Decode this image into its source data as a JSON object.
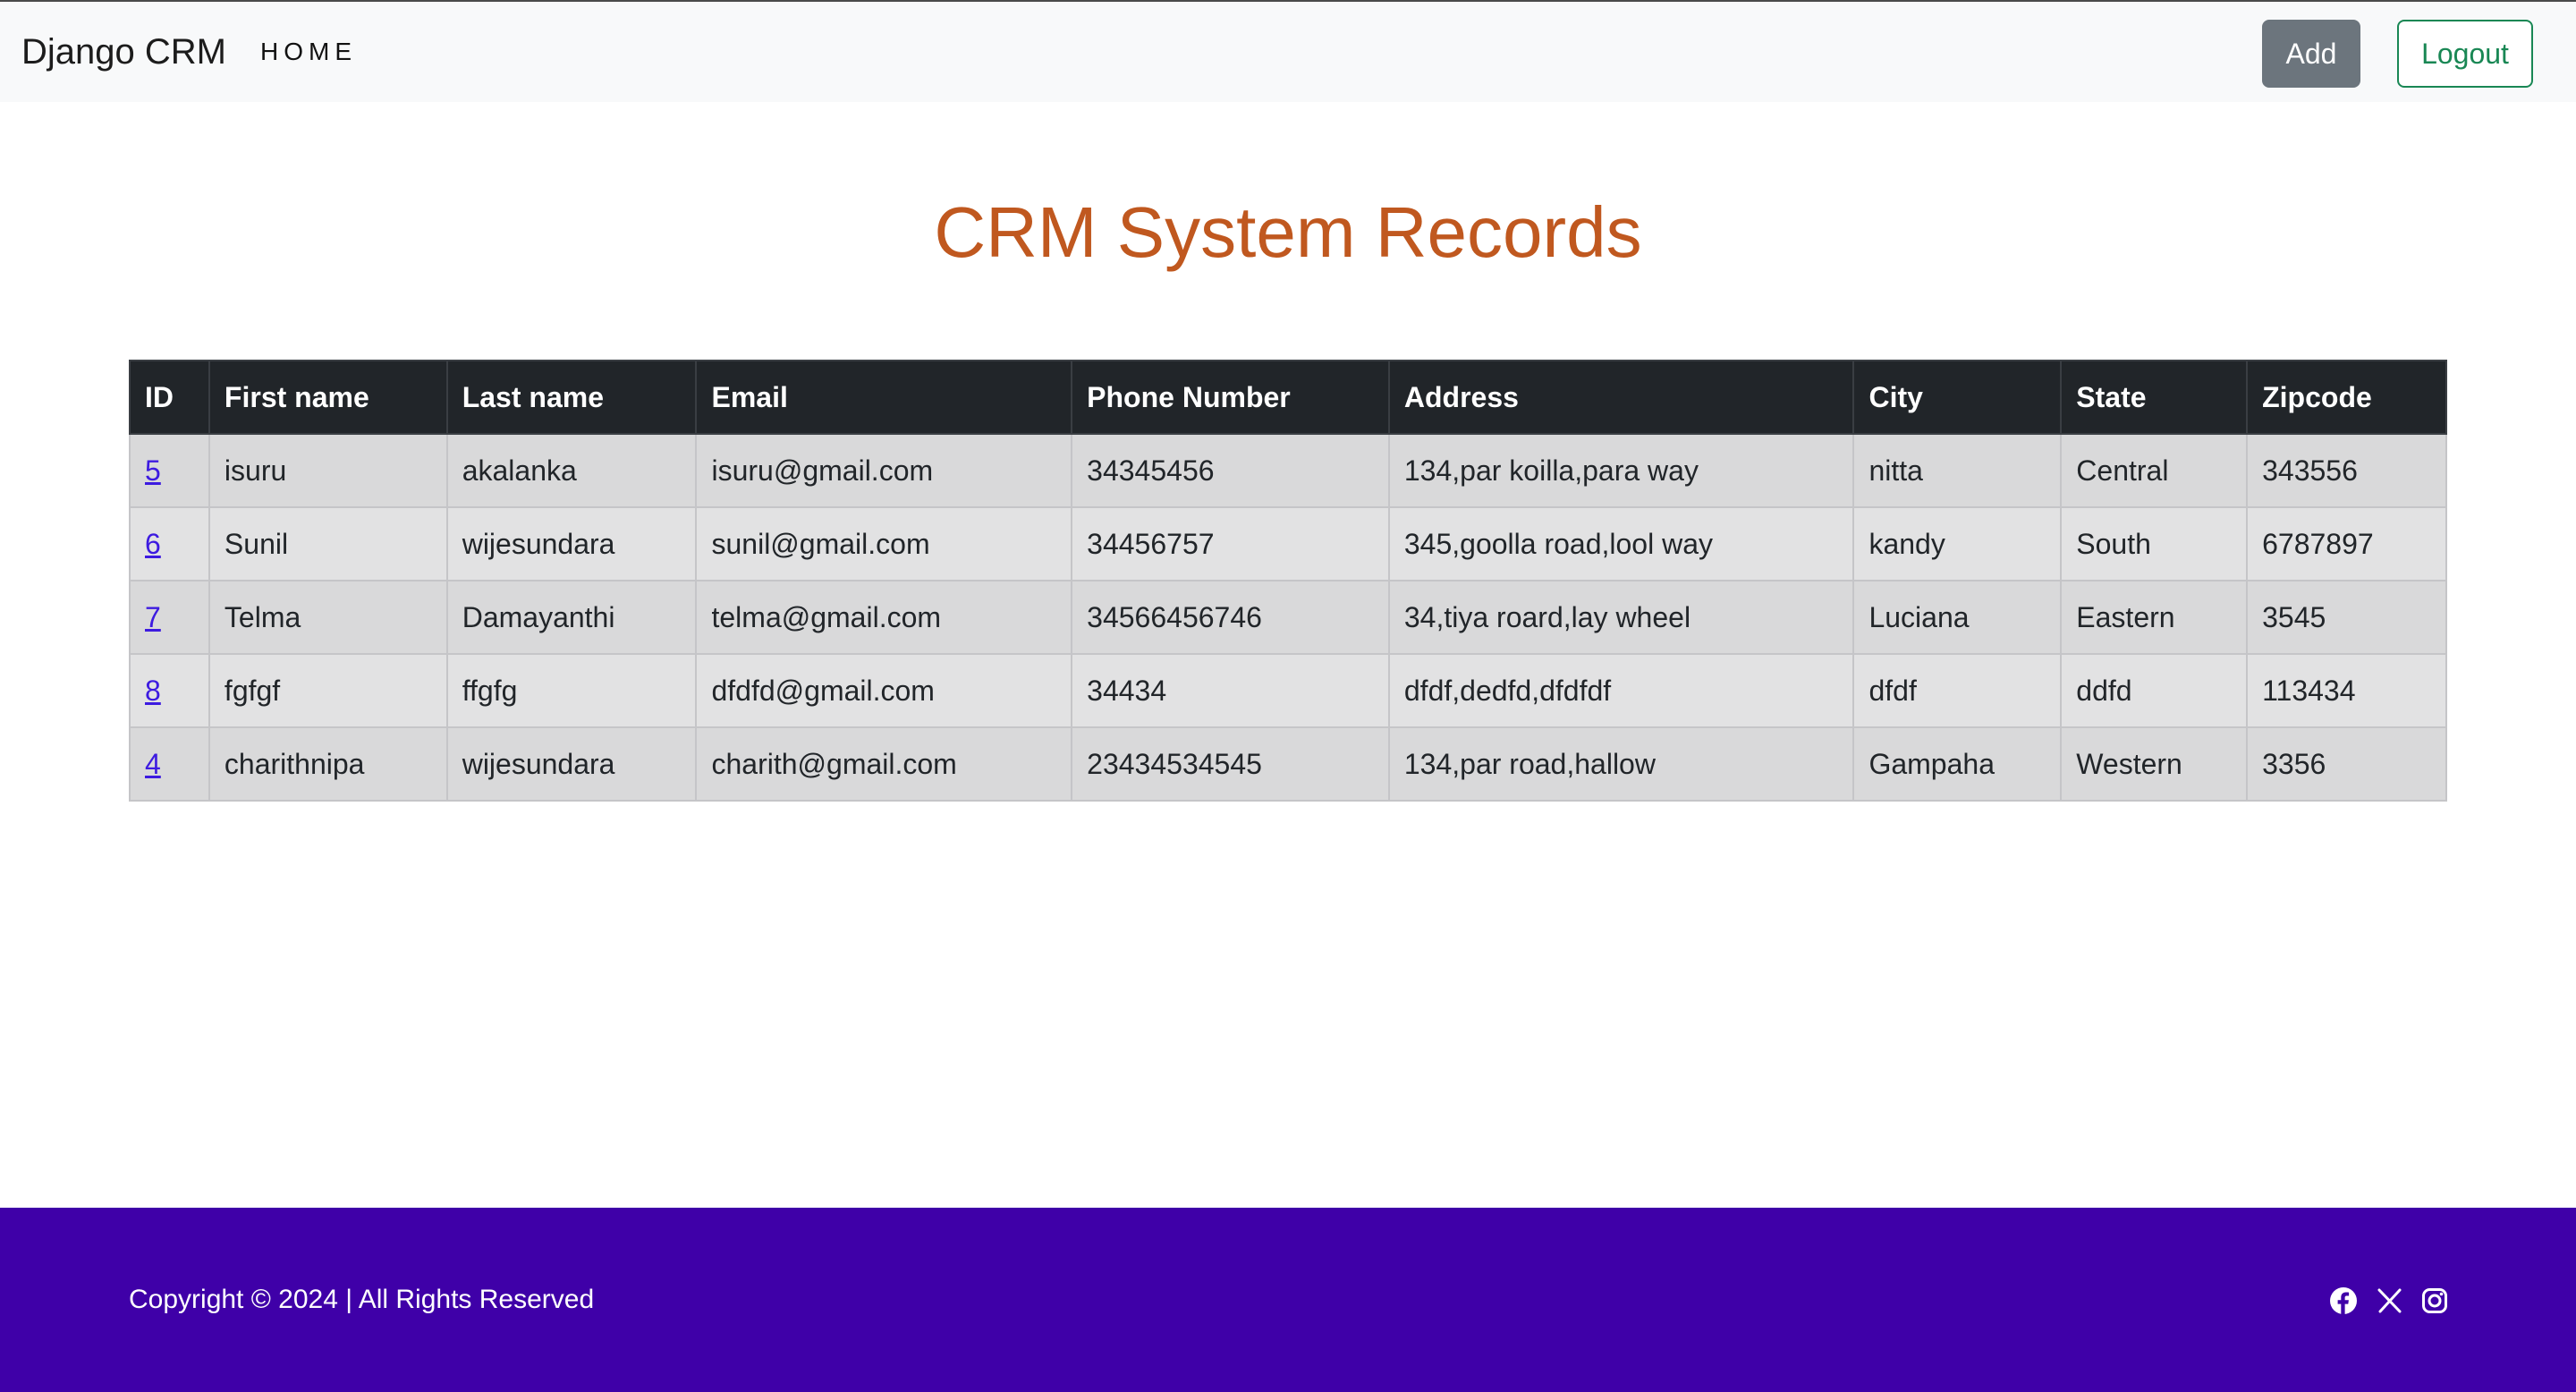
{
  "navbar": {
    "brand": "Django CRM",
    "home": "HOME",
    "add_label": "Add",
    "logout_label": "Logout"
  },
  "page": {
    "title": "CRM System Records"
  },
  "table": {
    "headers": [
      "ID",
      "First name",
      "Last name",
      "Email",
      "Phone Number",
      "Address",
      "City",
      "State",
      "Zipcode"
    ],
    "rows": [
      [
        "5",
        "isuru",
        "akalanka",
        "isuru@gmail.com",
        "34345456",
        "134,par koilla,para way",
        "nitta",
        "Central",
        "343556"
      ],
      [
        "6",
        "Sunil",
        "wijesundara",
        "sunil@gmail.com",
        "34456757",
        "345,goolla road,lool way",
        "kandy",
        "South",
        "6787897"
      ],
      [
        "7",
        "Telma",
        "Damayanthi",
        "telma@gmail.com",
        "34566456746",
        "34,tiya roard,lay wheel",
        "Luciana",
        "Eastern",
        "3545"
      ],
      [
        "8",
        "fgfgf",
        "ffgfg",
        "dfdfd@gmail.com",
        "34434",
        "dfdf,dedfd,dfdfdf",
        "dfdf",
        "ddfd",
        "113434"
      ],
      [
        "4",
        "charithnipa",
        "wijesundara",
        "charith@gmail.com",
        "23434534545",
        "134,par road,hallow",
        "Gampaha",
        "Western",
        "3356"
      ]
    ]
  },
  "footer": {
    "copyright": "Copyright © 2024 | All Rights Reserved",
    "social": [
      "facebook-icon",
      "x-icon",
      "instagram-icon"
    ]
  },
  "colors": {
    "title": "#c0581f",
    "footer_bg": "#3f00a8",
    "table_header_bg": "#212529",
    "add_button": "#6c757d",
    "logout_button": "#198754"
  }
}
